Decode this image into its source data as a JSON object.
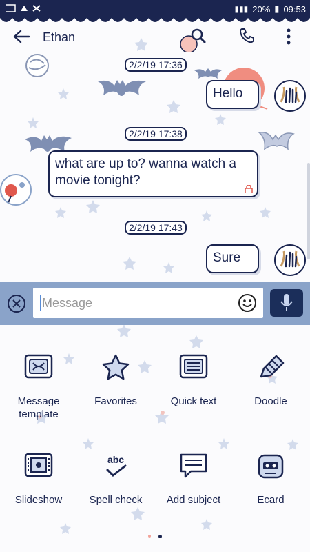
{
  "status_bar": {
    "battery": "20%",
    "time": "09:53"
  },
  "header": {
    "contact_name": "Ethan"
  },
  "chat": {
    "timestamps": [
      "2/2/19 17:36",
      "2/2/19 17:38",
      "2/2/19 17:43"
    ],
    "messages": [
      {
        "from": "me",
        "text": "Hello"
      },
      {
        "from": "contact",
        "text": "what are up to? wanna watch a movie tonight?"
      },
      {
        "from": "me",
        "text": "Sure"
      }
    ]
  },
  "composer": {
    "placeholder": "Message"
  },
  "attachments": {
    "items": [
      {
        "label": "Message\ntemplate",
        "icon": "message-template-icon"
      },
      {
        "label": "Favorites",
        "icon": "star-icon"
      },
      {
        "label": "Quick text",
        "icon": "quick-text-icon"
      },
      {
        "label": "Doodle",
        "icon": "pen-icon"
      },
      {
        "label": "Slideshow",
        "icon": "slideshow-icon"
      },
      {
        "label": "Spell check",
        "icon": "spell-check-icon"
      },
      {
        "label": "Add subject",
        "icon": "add-subject-icon"
      },
      {
        "label": "Ecard",
        "icon": "ecard-icon"
      }
    ],
    "page_indicator": {
      "current": 2,
      "total": 2
    }
  },
  "colors": {
    "navy": "#1b2550",
    "bar_blue": "#8aa3c9",
    "star": "#c9d2e6",
    "accent_red": "#e0584d"
  }
}
